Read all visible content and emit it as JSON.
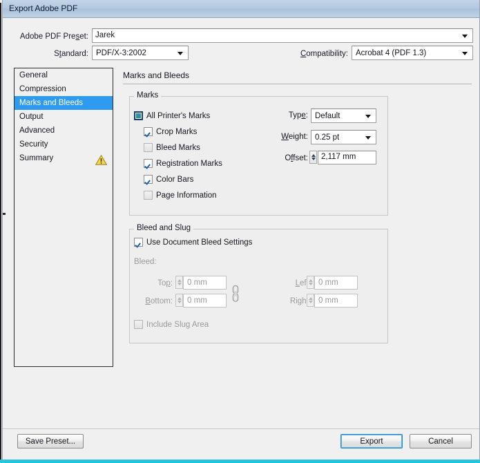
{
  "window": {
    "title": "Export Adobe PDF"
  },
  "header": {
    "preset_label": "Adobe PDF Preset:",
    "preset_label_pre": "Adobe PDF Pre",
    "preset_label_accel": "s",
    "preset_label_post": "et:",
    "preset_value": "Jarek",
    "standard_label_pre": "S",
    "standard_label_accel": "t",
    "standard_label_post": "andard:",
    "standard_value": "PDF/X-3:2002",
    "compatibility_label_pre": "",
    "compatibility_label_accel": "C",
    "compatibility_label_post": "ompatibility:",
    "compatibility_value": "Acrobat 4 (PDF 1.3)"
  },
  "sidebar": {
    "items": [
      {
        "label": "General",
        "selected": false
      },
      {
        "label": "Compression",
        "selected": false
      },
      {
        "label": "Marks and Bleeds",
        "selected": true
      },
      {
        "label": "Output",
        "selected": false
      },
      {
        "label": "Advanced",
        "selected": false
      },
      {
        "label": "Security",
        "selected": false
      },
      {
        "label": "Summary",
        "selected": false
      }
    ],
    "warning_icon": "warning-triangle-icon"
  },
  "pane": {
    "title": "Marks and Bleeds"
  },
  "marks_group": {
    "title": "Marks",
    "checkboxes": [
      {
        "label": "All Printer's Marks",
        "state": "mixed",
        "indent": 0
      },
      {
        "label": "Crop Marks",
        "state": "checked",
        "indent": 1
      },
      {
        "label": "Bleed Marks",
        "state": "empty",
        "indent": 1
      },
      {
        "label": "Registration Marks",
        "state": "checked",
        "indent": 1
      },
      {
        "label": "Color Bars",
        "state": "checked",
        "indent": 1
      },
      {
        "label": "Page Information",
        "state": "empty",
        "indent": 1
      }
    ],
    "type_label_pre": "Typ",
    "type_label_accel": "e",
    "type_label_post": ":",
    "type_value": "Default",
    "weight_label_pre": "",
    "weight_label_accel": "W",
    "weight_label_post": "eight:",
    "weight_value": "0.25 pt",
    "offset_label_pre": "O",
    "offset_label_accel": "f",
    "offset_label_post": "fset:",
    "offset_value": "2,117 mm"
  },
  "bleed_group": {
    "title": "Bleed and Slug",
    "use_doc_bleed_label": "Use Document Bleed Settings",
    "use_doc_bleed_state": "checked",
    "bleed_label": "Bleed:",
    "top_label_pre": "To",
    "top_label_accel": "p",
    "top_label_post": ":",
    "top_value": "0 mm",
    "bottom_label_pre": "",
    "bottom_label_accel": "B",
    "bottom_label_post": "ottom:",
    "bottom_value": "0 mm",
    "left_label_pre": "",
    "left_label_accel": "L",
    "left_label_post": "eft:",
    "left_value": "0 mm",
    "right_label_pre": "Ri",
    "right_label_accel": "g",
    "right_label_post": "ht:",
    "right_value": "0 mm",
    "chain_icon": "link-chain-icon",
    "include_slug_label": "Include Slug Area",
    "include_slug_state": "empty"
  },
  "footer": {
    "save_preset_label": "Save Preset...",
    "export_label": "Export",
    "cancel_label": "Cancel"
  },
  "colors": {
    "selection_blue": "#2e9bf0",
    "titlebar_blue": "#b2c9e0",
    "bottom_strip_cyan": "#29c5e0",
    "warning_yellow": "#f5d547",
    "default_button_ring": "#2c87c8"
  }
}
